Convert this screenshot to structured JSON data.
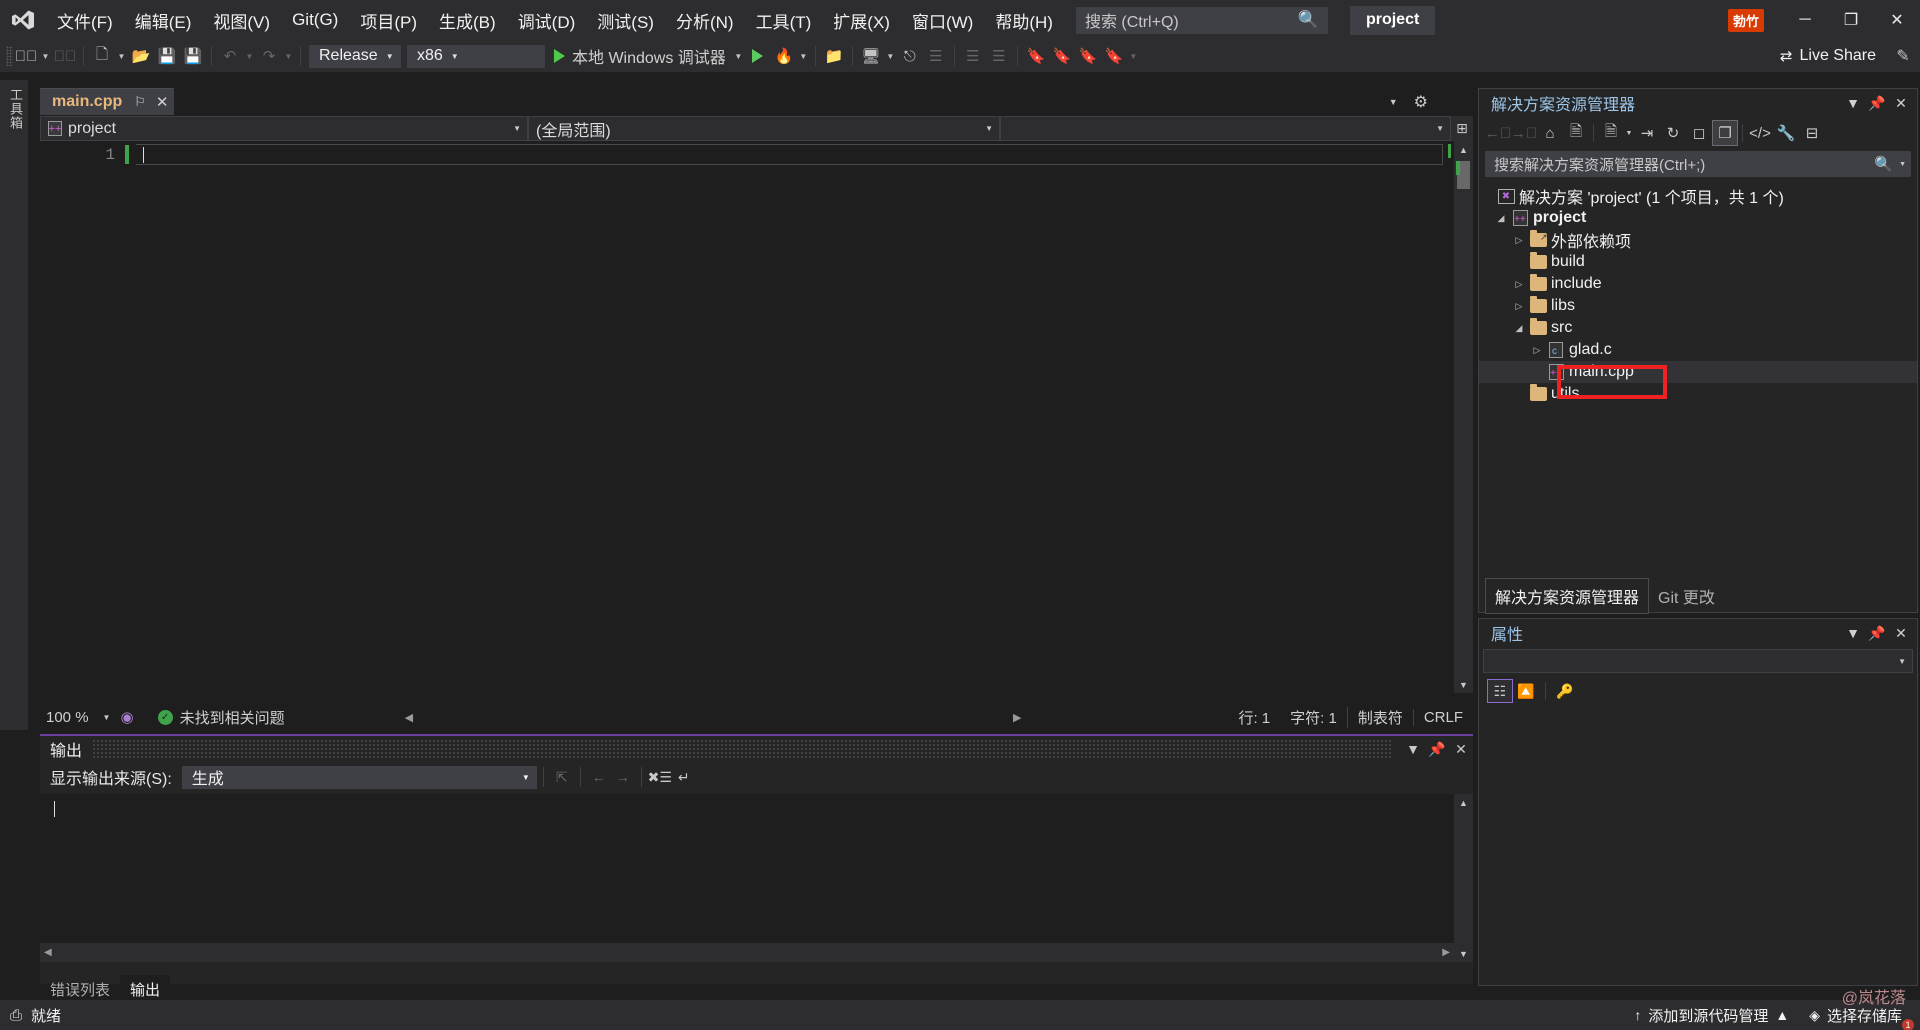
{
  "window": {
    "title": "project",
    "badge": "勃竹"
  },
  "menu": {
    "items": [
      {
        "label": "文件(F)",
        "key": "F"
      },
      {
        "label": "编辑(E)",
        "key": "E"
      },
      {
        "label": "视图(V)",
        "key": "V"
      },
      {
        "label": "Git(G)",
        "key": "G"
      },
      {
        "label": "项目(P)",
        "key": "P"
      },
      {
        "label": "生成(B)",
        "key": "B"
      },
      {
        "label": "调试(D)",
        "key": "D"
      },
      {
        "label": "测试(S)",
        "key": "S"
      },
      {
        "label": "分析(N)",
        "key": "N"
      },
      {
        "label": "工具(T)",
        "key": "T"
      },
      {
        "label": "扩展(X)",
        "key": "X"
      },
      {
        "label": "窗口(W)",
        "key": "W"
      },
      {
        "label": "帮助(H)",
        "key": "H"
      }
    ]
  },
  "search": {
    "placeholder": "搜索 (Ctrl+Q)",
    "icon": "search-icon"
  },
  "window_controls": {
    "minimize": "─",
    "maximize": "❐",
    "close": "✕"
  },
  "toolbar": {
    "config": "Release",
    "platform": "x86",
    "run_label": "本地 Windows 调试器",
    "live_share": "Live Share"
  },
  "editor": {
    "vertical_strip_label": "工具箱",
    "tab": {
      "name": "main.cpp",
      "pin": "⚐",
      "close": "✕"
    },
    "nav_project": "project",
    "nav_scope": "(全局范围)",
    "nav_member": "",
    "line_number": "1",
    "code_text": "",
    "status": {
      "zoom": "100 %",
      "issues": "未找到相关问题",
      "line_label": "行: 1",
      "char_label": "字符: 1",
      "tab_label": "制表符",
      "eol": "CRLF"
    }
  },
  "output": {
    "title": "输出",
    "source_label": "显示输出来源(S):",
    "source_value": "生成",
    "body_text": ""
  },
  "bottom_tabs": [
    {
      "label": "错误列表",
      "active": false
    },
    {
      "label": "输出",
      "active": true
    }
  ],
  "solution_explorer": {
    "title": "解决方案资源管理器",
    "search_placeholder": "搜索解决方案资源管理器(Ctrl+;)",
    "tree": [
      {
        "label": "解决方案 'project' (1 个项目，共 1 个)",
        "indent": 0,
        "icon": "solution-icon",
        "expander": "none",
        "bold": false
      },
      {
        "label": "project",
        "indent": 1,
        "icon": "cpp-project-icon",
        "expander": "open",
        "bold": true
      },
      {
        "label": "外部依赖项",
        "indent": 2,
        "icon": "folder-external-icon",
        "expander": "closed",
        "bold": false
      },
      {
        "label": "build",
        "indent": 2,
        "icon": "folder-icon",
        "expander": "none",
        "bold": false
      },
      {
        "label": "include",
        "indent": 2,
        "icon": "folder-icon",
        "expander": "closed",
        "bold": false
      },
      {
        "label": "libs",
        "indent": 2,
        "icon": "folder-icon",
        "expander": "closed",
        "bold": false
      },
      {
        "label": "src",
        "indent": 2,
        "icon": "folder-icon",
        "expander": "open",
        "bold": false
      },
      {
        "label": "glad.c",
        "indent": 3,
        "icon": "c-file-icon",
        "expander": "closed",
        "bold": false
      },
      {
        "label": "main.cpp",
        "indent": 3,
        "icon": "cpp-file-icon",
        "expander": "none",
        "bold": false,
        "selected": true
      },
      {
        "label": "utils",
        "indent": 2,
        "icon": "folder-icon",
        "expander": "none",
        "bold": false
      }
    ],
    "footer_tabs": [
      {
        "label": "解决方案资源管理器",
        "active": true
      },
      {
        "label": "Git 更改",
        "active": false
      }
    ]
  },
  "properties": {
    "title": "属性",
    "selected_object": ""
  },
  "statusbar": {
    "ready": "就绪",
    "source_control": "添加到源代码管理",
    "repo": "选择存储库",
    "watermark": "@岚花落"
  },
  "colors": {
    "accent_purple": "#6b3fa0",
    "annotation_red": "#ee2222",
    "chrome": "#2d2d30",
    "editor_bg": "#1e1e1e",
    "panel_bg": "#252526",
    "folder": "#dcb67a",
    "tab_text": "#e8b87d",
    "panel_title": "#9cc5e8",
    "run_green": "#4ec94e"
  }
}
